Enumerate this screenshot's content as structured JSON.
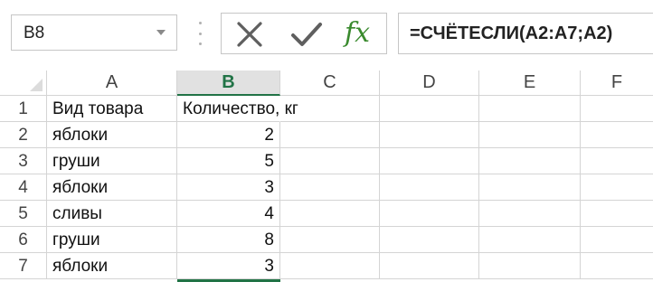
{
  "name_box": {
    "value": "B8"
  },
  "formula_bar": {
    "fx_label": "fx",
    "formula": "=СЧЁТЕСЛИ(A2:A7;A2)"
  },
  "colors": {
    "accent": "#217346",
    "fx_green": "#3a8a2e",
    "grid_line": "#d4d4d4"
  },
  "columns": [
    "A",
    "B",
    "C",
    "D",
    "E",
    "F"
  ],
  "active_column": "B",
  "rows": [
    {
      "num": "1",
      "a": "Вид товара",
      "b": "Количество, кг"
    },
    {
      "num": "2",
      "a": "яблоки",
      "b": "2"
    },
    {
      "num": "3",
      "a": "груши",
      "b": "5"
    },
    {
      "num": "4",
      "a": "яблоки",
      "b": "3"
    },
    {
      "num": "5",
      "a": "сливы",
      "b": "4"
    },
    {
      "num": "6",
      "a": "груши",
      "b": "8"
    },
    {
      "num": "7",
      "a": "яблоки",
      "b": "3"
    }
  ],
  "icons": {
    "cancel": "close-x-icon",
    "enter": "checkmark-icon",
    "function": "insert-function-icon",
    "dropdown": "chevron-down-icon"
  }
}
